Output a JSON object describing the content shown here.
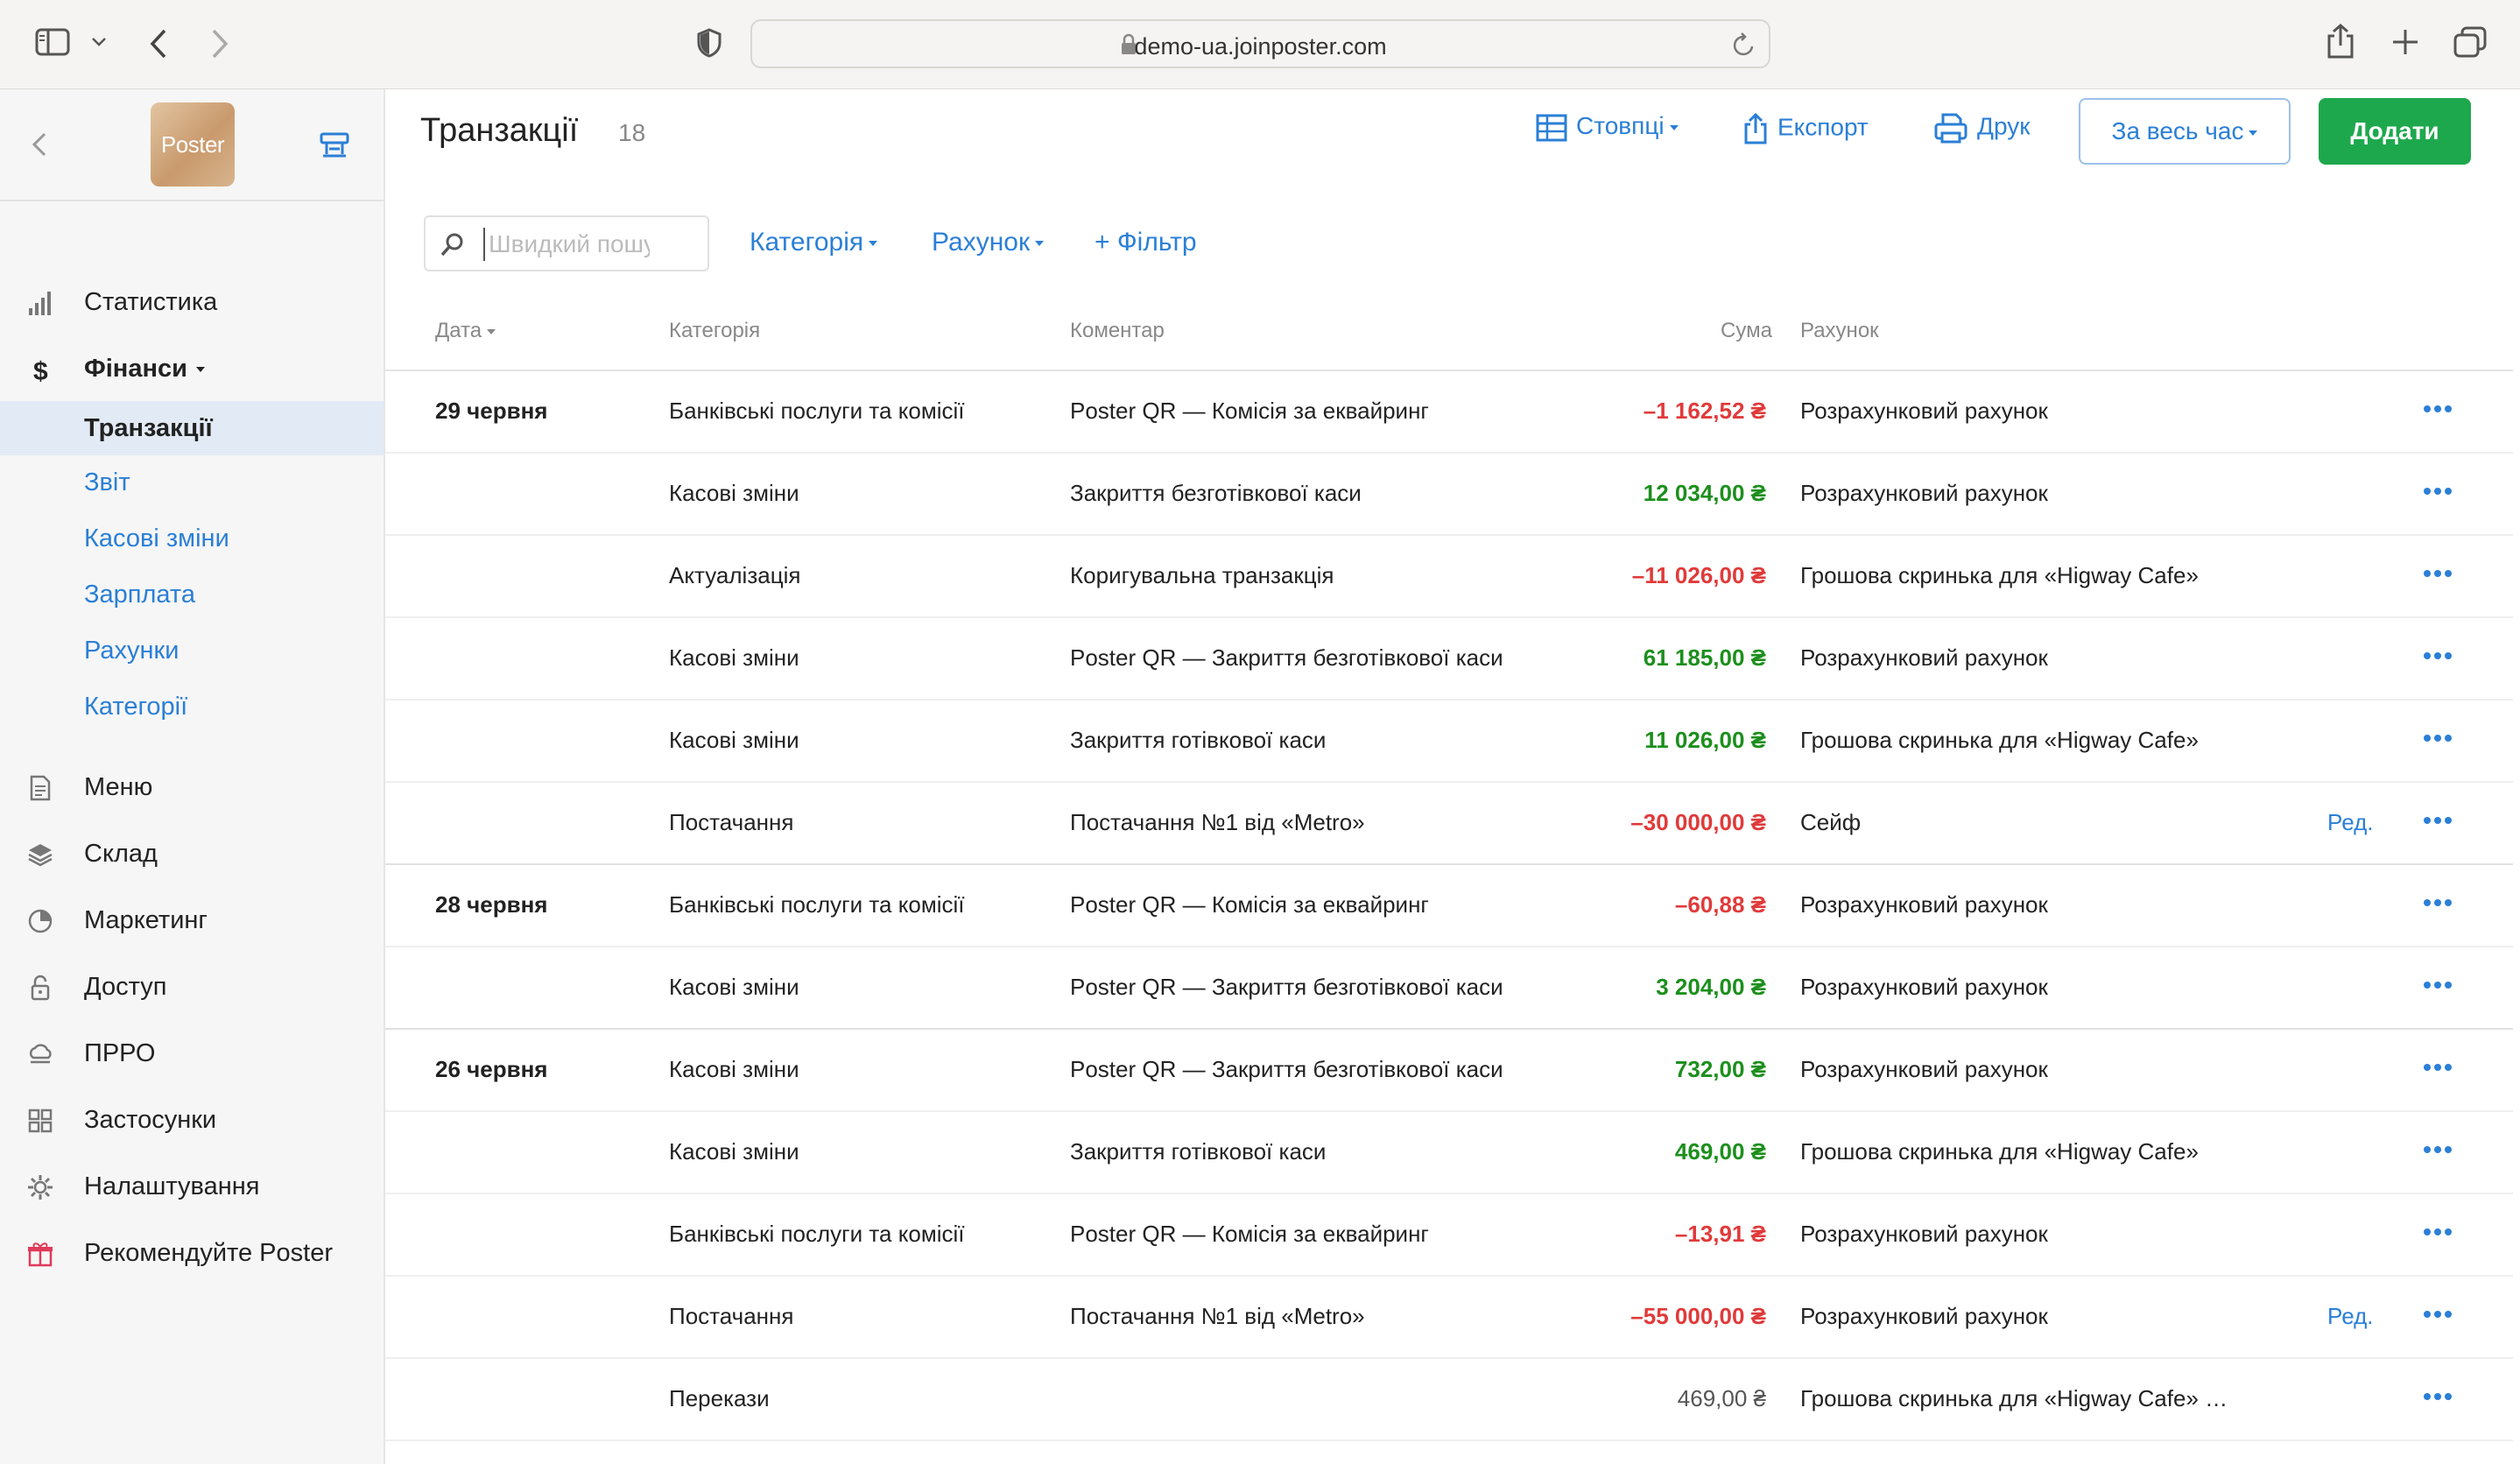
{
  "browser": {
    "url": "demo-ua.joinposter.com"
  },
  "sidebar": {
    "logo_text": "Poster",
    "items": [
      {
        "label": "Статистика",
        "icon": "bar-chart-icon"
      },
      {
        "label": "Фінанси",
        "icon": "dollar-icon"
      },
      {
        "label": "Меню",
        "icon": "document-icon"
      },
      {
        "label": "Склад",
        "icon": "layers-icon"
      },
      {
        "label": "Маркетинг",
        "icon": "pie-icon"
      },
      {
        "label": "Доступ",
        "icon": "lock-icon"
      },
      {
        "label": "ПРРО",
        "icon": "cloud-icon"
      },
      {
        "label": "Застосунки",
        "icon": "grid-icon"
      },
      {
        "label": "Налаштування",
        "icon": "gear-icon"
      },
      {
        "label": "Рекомендуйте Poster",
        "icon": "gift-icon"
      }
    ],
    "finance_sub": [
      {
        "label": "Транзакції",
        "active": true
      },
      {
        "label": "Звіт"
      },
      {
        "label": "Касові зміни"
      },
      {
        "label": "Зарплата"
      },
      {
        "label": "Рахунки"
      },
      {
        "label": "Категорії"
      }
    ]
  },
  "header": {
    "title": "Транзакції",
    "count": "18",
    "columns_btn": "Стовпці",
    "export_btn": "Експорт",
    "print_btn": "Друк",
    "period_btn": "За весь час",
    "add_btn": "Додати"
  },
  "filters": {
    "search_placeholder": "Швидкий пошук",
    "category": "Категорія",
    "account": "Рахунок",
    "add_filter": "+ Фільтр"
  },
  "table": {
    "headers": {
      "date": "Дата",
      "category": "Категорія",
      "comment": "Коментар",
      "sum": "Сума",
      "account": "Рахунок"
    },
    "edit_label": "Ред.",
    "rows": [
      {
        "date": "29 червня",
        "category": "Банківські послуги та комісії",
        "comment": "Poster QR — Комісія за еквайринг",
        "sum": "–1 162,52 ₴",
        "sign": "neg",
        "account": "Розрахунковий рахунок",
        "edit": false
      },
      {
        "date": "",
        "category": "Касові зміни",
        "comment": "Закриття безготівкової каси",
        "sum": "12 034,00 ₴",
        "sign": "pos",
        "account": "Розрахунковий рахунок",
        "edit": false
      },
      {
        "date": "",
        "category": "Актуалізація",
        "comment": "Коригувальна транзакція",
        "sum": "–11 026,00 ₴",
        "sign": "neg",
        "account": "Грошова скринька для «Higway Cafe»",
        "edit": false
      },
      {
        "date": "",
        "category": "Касові зміни",
        "comment": "Poster QR — Закриття безготівкової каси",
        "sum": "61 185,00 ₴",
        "sign": "pos",
        "account": "Розрахунковий рахунок",
        "edit": false
      },
      {
        "date": "",
        "category": "Касові зміни",
        "comment": "Закриття готівкової каси",
        "sum": "11 026,00 ₴",
        "sign": "pos",
        "account": "Грошова скринька для «Higway Cafe»",
        "edit": false
      },
      {
        "date": "",
        "category": "Постачання",
        "comment": "Постачання №1 від «Metro»",
        "sum": "–30 000,00 ₴",
        "sign": "neg",
        "account": "Сейф",
        "edit": true
      },
      {
        "date": "28 червня",
        "category": "Банківські послуги та комісії",
        "comment": "Poster QR — Комісія за еквайринг",
        "sum": "–60,88 ₴",
        "sign": "neg",
        "account": "Розрахунковий рахунок",
        "edit": false
      },
      {
        "date": "",
        "category": "Касові зміни",
        "comment": "Poster QR — Закриття безготівкової каси",
        "sum": "3 204,00 ₴",
        "sign": "pos",
        "account": "Розрахунковий рахунок",
        "edit": false
      },
      {
        "date": "26 червня",
        "category": "Касові зміни",
        "comment": "Poster QR — Закриття безготівкової каси",
        "sum": "732,00 ₴",
        "sign": "pos",
        "account": "Розрахунковий рахунок",
        "edit": false
      },
      {
        "date": "",
        "category": "Касові зміни",
        "comment": "Закриття готівкової каси",
        "sum": "469,00 ₴",
        "sign": "pos",
        "account": "Грошова скринька для «Higway Cafe»",
        "edit": false
      },
      {
        "date": "",
        "category": "Банківські послуги та комісії",
        "comment": "Poster QR — Комісія за еквайринг",
        "sum": "–13,91 ₴",
        "sign": "neg",
        "account": "Розрахунковий рахунок",
        "edit": false
      },
      {
        "date": "",
        "category": "Постачання",
        "comment": "Постачання №1 від «Metro»",
        "sum": "–55 000,00 ₴",
        "sign": "neg",
        "account": "Розрахунковий рахунок",
        "edit": true
      },
      {
        "date": "",
        "category": "Перекази",
        "comment": "",
        "sum": "469,00 ₴",
        "sign": "neu",
        "account": "Грошова скринька для «Higway Cafe» …",
        "edit": false
      }
    ]
  },
  "colors": {
    "accent": "#2b7fd6",
    "add_green": "#1ea84d",
    "negative": "#e03a3a",
    "positive": "#1c8f1c"
  }
}
